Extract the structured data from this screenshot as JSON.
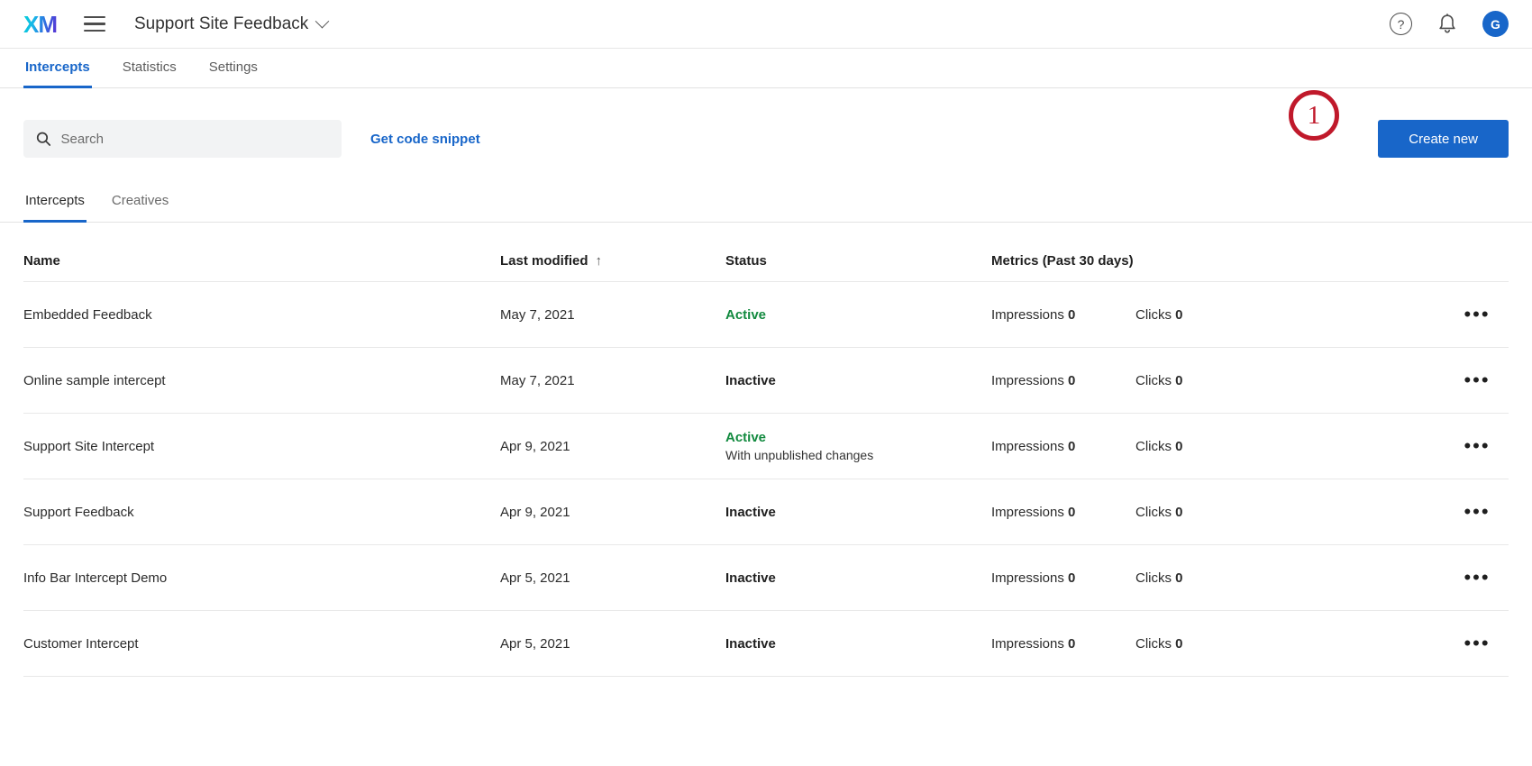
{
  "topbar": {
    "logo_text": "XM",
    "project_title": "Support Site Feedback",
    "help_glyph": "?",
    "avatar_initial": "G"
  },
  "main_tabs": [
    {
      "label": "Intercepts",
      "active": true
    },
    {
      "label": "Statistics",
      "active": false
    },
    {
      "label": "Settings",
      "active": false
    }
  ],
  "toolbar": {
    "search_placeholder": "Search",
    "search_value": "",
    "code_snippet_label": "Get code snippet",
    "create_new_label": "Create new",
    "annotation_badge": "1"
  },
  "sub_tabs": [
    {
      "label": "Intercepts",
      "active": true
    },
    {
      "label": "Creatives",
      "active": false
    }
  ],
  "table": {
    "headers": {
      "name": "Name",
      "last_modified": "Last modified",
      "sort_arrow": "↑",
      "status": "Status",
      "metrics": "Metrics (Past 30 days)"
    },
    "metric_labels": {
      "impressions": "Impressions",
      "clicks": "Clicks"
    },
    "menu_glyph": "•••",
    "rows": [
      {
        "name": "Embedded Feedback",
        "last_modified": "May 7, 2021",
        "status": "Active",
        "status_state": "active",
        "status_sub": "",
        "impressions": "0",
        "clicks": "0"
      },
      {
        "name": "Online sample intercept",
        "last_modified": "May 7, 2021",
        "status": "Inactive",
        "status_state": "inactive",
        "status_sub": "",
        "impressions": "0",
        "clicks": "0"
      },
      {
        "name": "Support Site Intercept",
        "last_modified": "Apr 9, 2021",
        "status": "Active",
        "status_state": "active",
        "status_sub": "With unpublished changes",
        "impressions": "0",
        "clicks": "0"
      },
      {
        "name": "Support Feedback",
        "last_modified": "Apr 9, 2021",
        "status": "Inactive",
        "status_state": "inactive",
        "status_sub": "",
        "impressions": "0",
        "clicks": "0"
      },
      {
        "name": "Info Bar Intercept Demo",
        "last_modified": "Apr 5, 2021",
        "status": "Inactive",
        "status_state": "inactive",
        "status_sub": "",
        "impressions": "0",
        "clicks": "0"
      },
      {
        "name": "Customer Intercept",
        "last_modified": "Apr 5, 2021",
        "status": "Inactive",
        "status_state": "inactive",
        "status_sub": "",
        "impressions": "0",
        "clicks": "0"
      }
    ]
  },
  "colors": {
    "accent_blue": "#1866c9",
    "status_active_green": "#128a3f",
    "annotation_red": "#c0192b",
    "search_bg": "#f2f3f4"
  }
}
